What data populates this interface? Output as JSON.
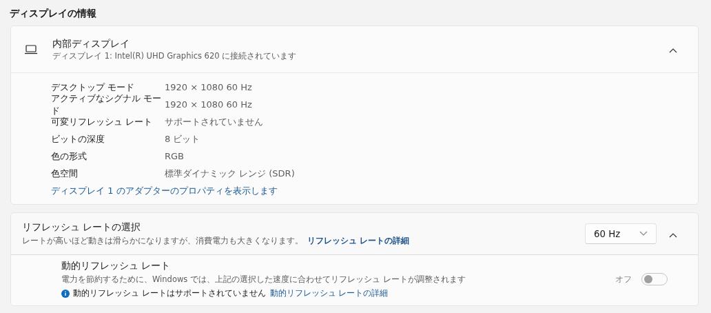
{
  "section_title": "ディスプレイの情報",
  "display": {
    "name": "内部ディスプレイ",
    "subtitle": "ディスプレイ 1: Intel(R) UHD Graphics 620 に接続されています",
    "expanded": true,
    "properties": [
      {
        "label": "デスクトップ モード",
        "value": "1920 × 1080 60 Hz"
      },
      {
        "label": "アクティブなシグナル モード",
        "value": "1920 × 1080 60 Hz"
      },
      {
        "label": "可変リフレッシュ レート",
        "value": "サポートされていません"
      },
      {
        "label": "ビットの深度",
        "value": "8 ビット"
      },
      {
        "label": "色の形式",
        "value": "RGB"
      },
      {
        "label": "色空間",
        "value": "標準ダイナミック レンジ (SDR)"
      }
    ],
    "adapter_link": "ディスプレイ 1 のアダプターのプロパティを表示します"
  },
  "refresh": {
    "title": "リフレッシュ レートの選択",
    "description": "レートが高いほど動きは滑らかになりますが、消費電力も大きくなります。",
    "link": "リフレッシュ レートの詳細",
    "rate": "60 Hz",
    "expanded": true,
    "dynamic": {
      "title": "動的リフレッシュ レート",
      "description": "電力を節約するために、Windows では、上記の選択した速度に合わせてリフレッシュ レートが調整されます",
      "notice": "動的リフレッシュ レートはサポートされていません",
      "notice_link": "動的リフレッシュ レートの詳細",
      "state_label": "オフ",
      "on": false,
      "disabled": true
    }
  }
}
